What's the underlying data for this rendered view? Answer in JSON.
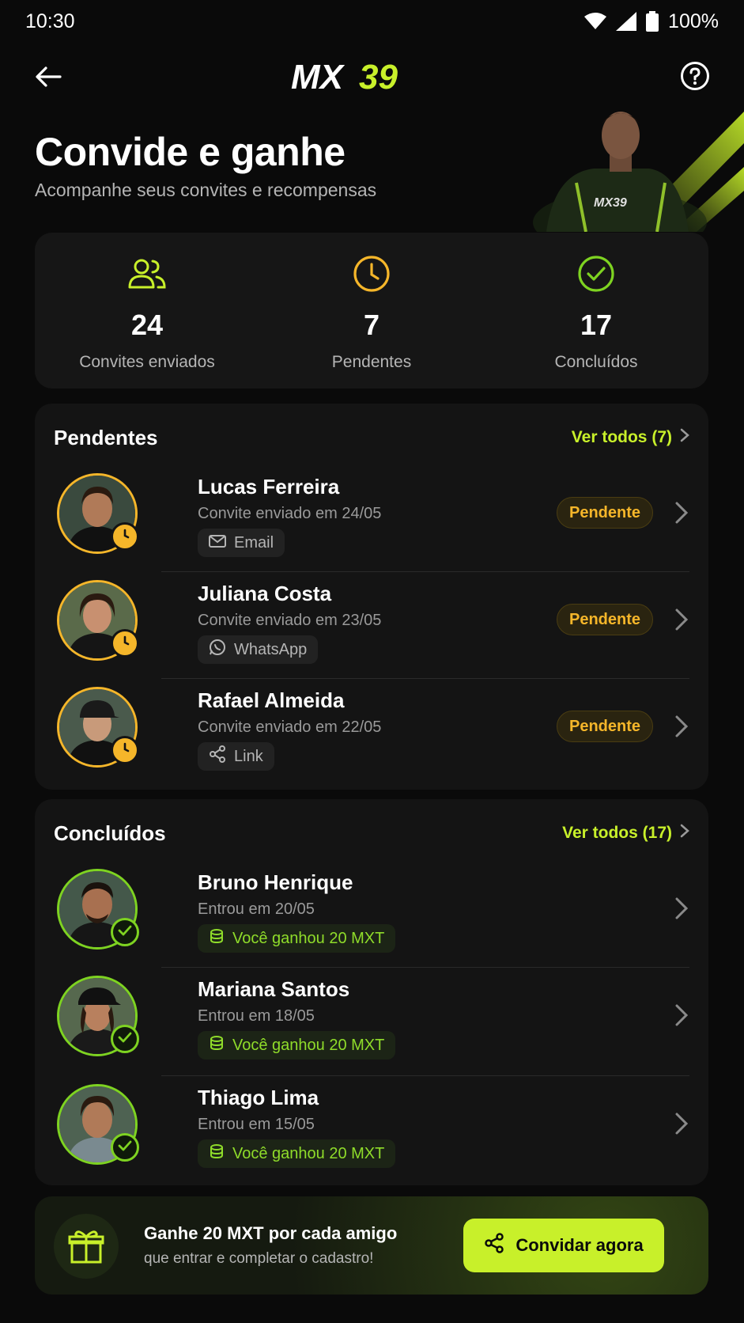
{
  "status_bar": {
    "time": "10:30",
    "battery": "100%"
  },
  "header": {
    "logo_text": "MX39"
  },
  "hero": {
    "title": "Convide e ganhe",
    "subtitle": "Acompanhe seus convites e recompensas"
  },
  "stats": [
    {
      "icon": "users-icon",
      "value": "24",
      "label": "Convites enviados",
      "color": "#c8f02a"
    },
    {
      "icon": "clock-icon",
      "value": "7",
      "label": "Pendentes",
      "color": "#f5b62a"
    },
    {
      "icon": "check-circle-icon",
      "value": "17",
      "label": "Concluídos",
      "color": "#7ed321"
    }
  ],
  "pending": {
    "title": "Pendentes",
    "see_all": "Ver todos (7)",
    "items": [
      {
        "name": "Lucas Ferreira",
        "meta": "Convite enviado em 24/05",
        "channel": "Email",
        "channel_icon": "mail-icon",
        "status": "Pendente"
      },
      {
        "name": "Juliana Costa",
        "meta": "Convite enviado em 23/05",
        "channel": "WhatsApp",
        "channel_icon": "whatsapp-icon",
        "status": "Pendente"
      },
      {
        "name": "Rafael Almeida",
        "meta": "Convite enviado em 22/05",
        "channel": "Link",
        "channel_icon": "share-icon",
        "status": "Pendente"
      }
    ]
  },
  "done": {
    "title": "Concluídos",
    "see_all": "Ver todos (17)",
    "items": [
      {
        "name": "Bruno Henrique",
        "meta": "Entrou em 20/05",
        "reward": "Você ganhou 20 MXT"
      },
      {
        "name": "Mariana Santos",
        "meta": "Entrou em 18/05",
        "reward": "Você ganhou 20 MXT"
      },
      {
        "name": "Thiago Lima",
        "meta": "Entrou em 15/05",
        "reward": "Você ganhou 20 MXT"
      }
    ]
  },
  "cta": {
    "title": "Ganhe 20 MXT por cada amigo",
    "subtitle": "que entrar e completar o cadastro!",
    "button": "Convidar agora"
  },
  "colors": {
    "accent": "#c8f02a",
    "pending": "#f5b62a",
    "success": "#7ed321",
    "background": "#0a0a0a"
  }
}
